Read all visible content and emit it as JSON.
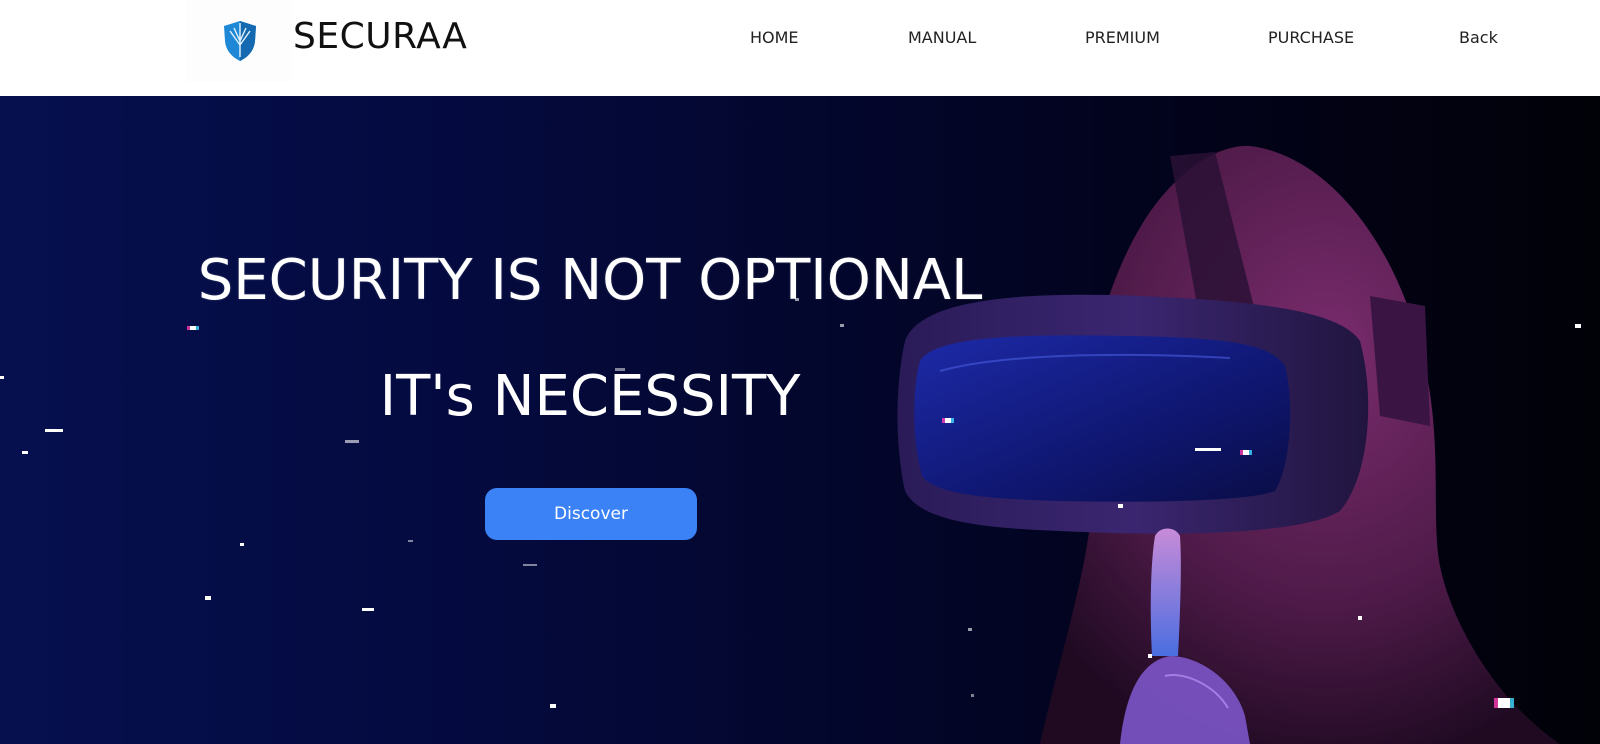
{
  "brand": {
    "name": "SECURAA",
    "logo_icon": "shield-icon"
  },
  "nav": {
    "home": "HOME",
    "manual": "MANUAL",
    "premium": "PREMIUM",
    "purchase": "PURCHASE",
    "back": "Back"
  },
  "hero": {
    "headline": "SECURITY IS NOT OPTIONAL",
    "subheadline": "IT's NECESSITY",
    "cta_label": "Discover",
    "image": "person-in-vr-headset-hood"
  },
  "colors": {
    "cta": "#3b82f6",
    "hero_bg_left": "#06104f",
    "hero_bg_right": "#010108",
    "hood": "#5a1f52",
    "logo_blue": "#1e88d6"
  }
}
